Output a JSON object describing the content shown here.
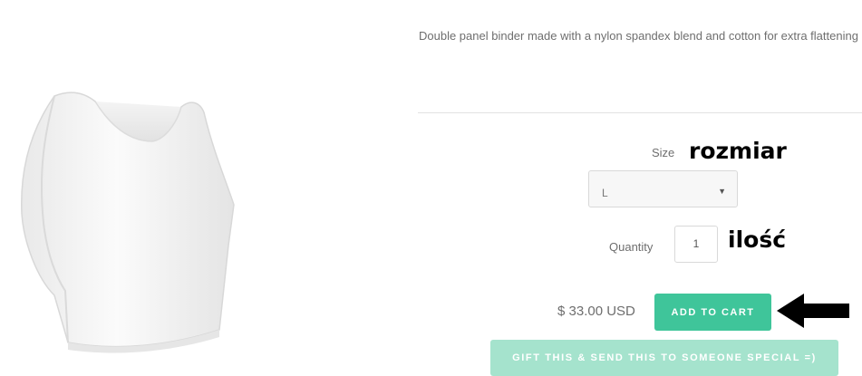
{
  "product": {
    "description": "Double panel binder made with a nylon spandex blend and cotton for extra flattening",
    "image_alt": "white binder top"
  },
  "size": {
    "label": "Size",
    "annotation": "rozmiar",
    "selected": "L"
  },
  "quantity": {
    "label": "Quantity",
    "annotation": "ilość",
    "value": "1"
  },
  "price": "$ 33.00 USD",
  "buttons": {
    "add_to_cart": "ADD TO CART",
    "gift": "GIFT THIS & SEND THIS TO SOMEONE SPECIAL =)"
  },
  "colors": {
    "accent": "#3fc59a",
    "accent_light": "#a5e3cd"
  }
}
